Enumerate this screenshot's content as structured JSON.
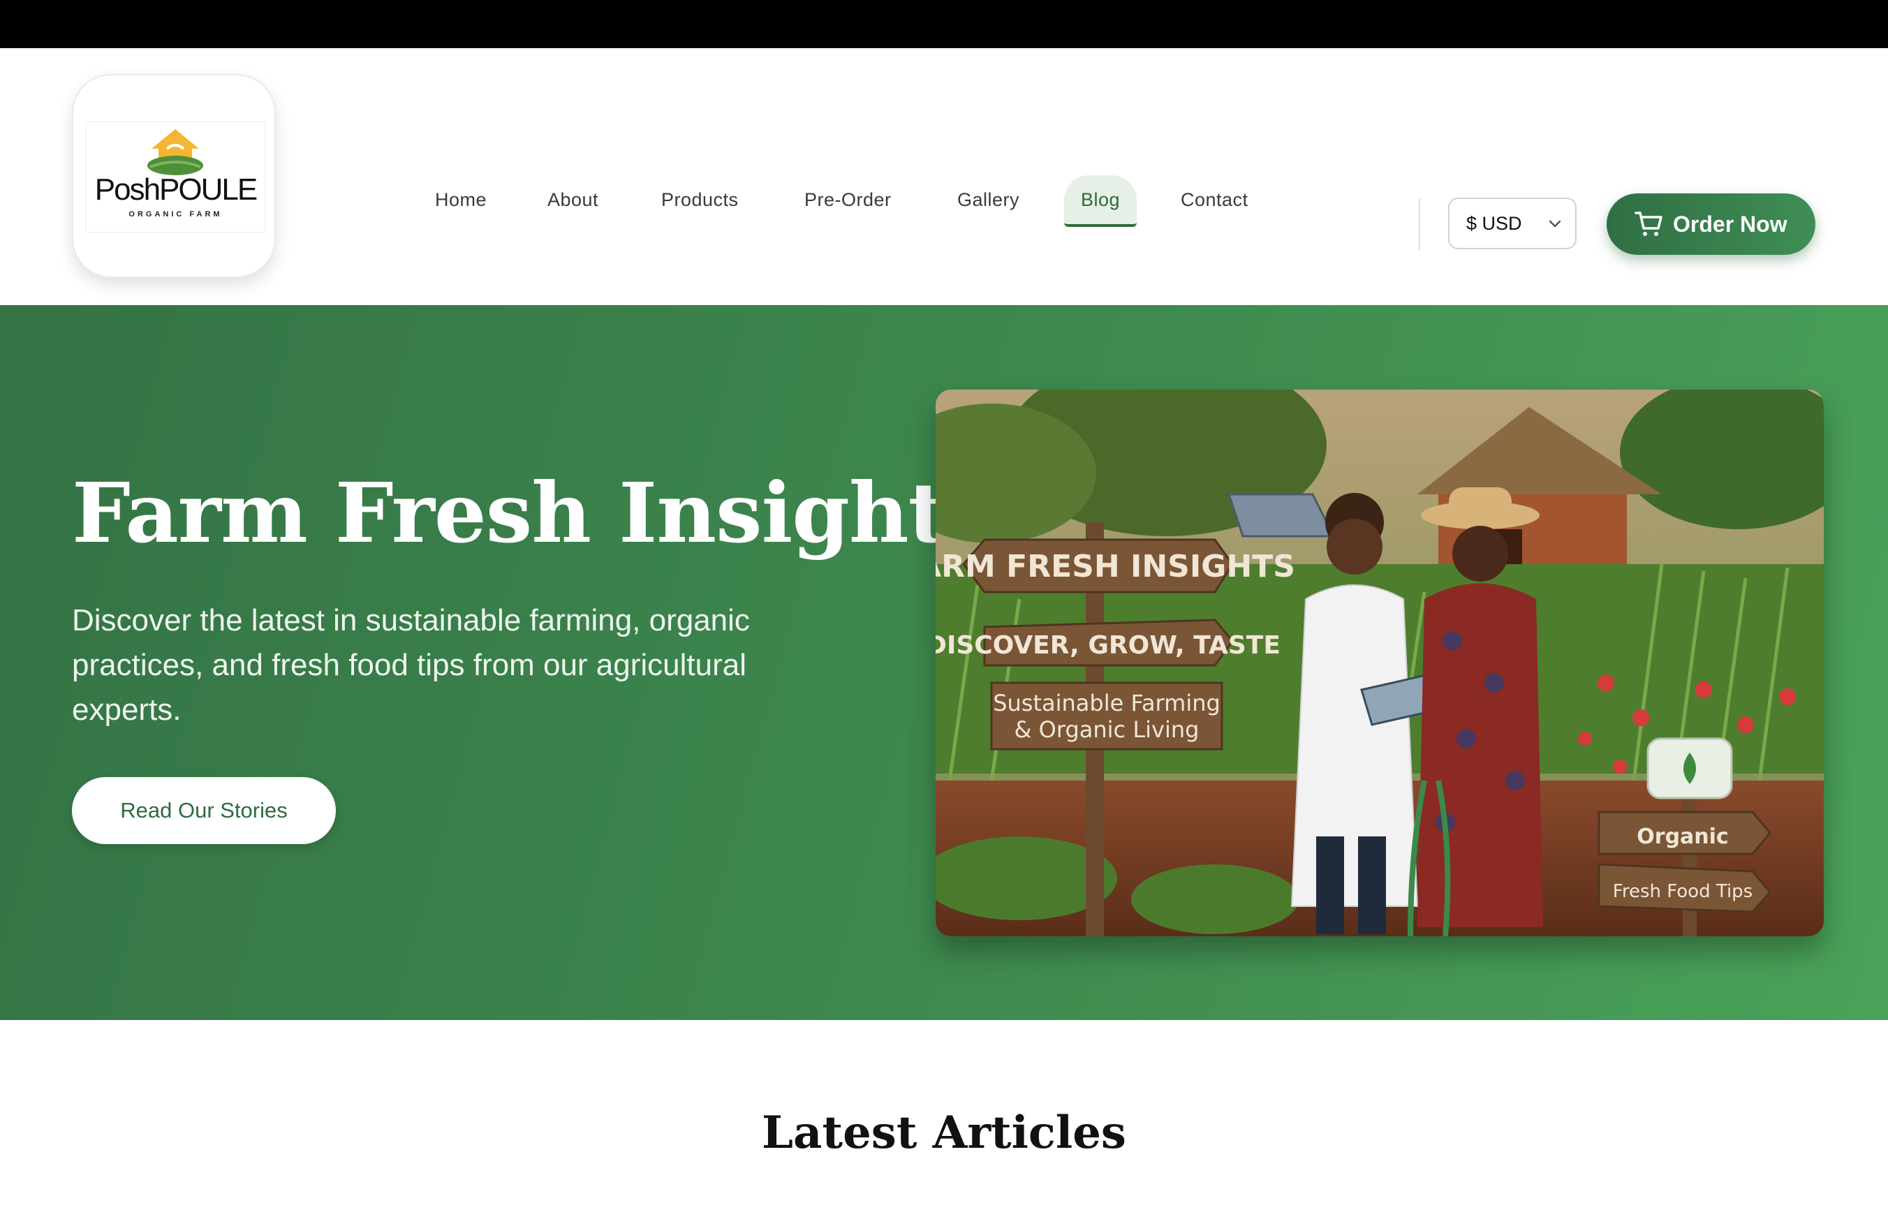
{
  "logo": {
    "wordmark": "PoshPOULE",
    "tagline": "ORGANIC FARM"
  },
  "nav": {
    "items": [
      "Home",
      "About",
      "Products",
      "Pre-Order",
      "Gallery",
      "Blog",
      "Contact"
    ],
    "active": "Blog"
  },
  "currency": {
    "selected": "$ USD"
  },
  "order_button": {
    "label": "Order Now",
    "icon": "cart-icon"
  },
  "hero": {
    "title": "Farm Fresh Insights",
    "subtitle": "Discover the latest in sustainable farming, organic practices, and fresh food tips from our agricultural experts.",
    "cta": "Read Our Stories",
    "image_signs": {
      "sign1": "FARM FRESH INSIGHTS",
      "sign2": "DISCOVER, GROW, TASTE",
      "sign3_line1": "Sustainable Farming",
      "sign3_line2": "& Organic Living",
      "sign4": "Organic",
      "sign5": "Fresh Food Tips"
    }
  },
  "section": {
    "latest_title": "Latest Articles"
  },
  "colors": {
    "brand_green": "#2f6f43",
    "hero_green": "#3e8a4f",
    "active_bg": "#e6f0e6"
  }
}
